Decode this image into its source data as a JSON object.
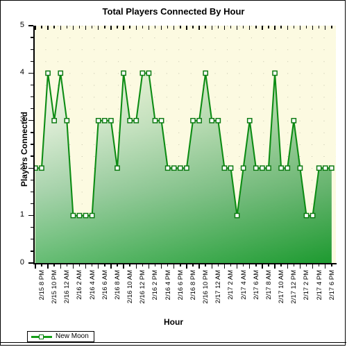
{
  "chart_data": {
    "type": "line",
    "title": "Total Players Connected By Hour",
    "xlabel": "Hour",
    "ylabel": "Players Connected",
    "ylim": [
      0,
      5
    ],
    "ytick_step": 1,
    "yticks": [
      0,
      1,
      2,
      3,
      4,
      5
    ],
    "grid": "dotted",
    "legend_position": "bottom-left",
    "series": [
      {
        "name": "New Moon",
        "color": "#15a018",
        "marker": "square",
        "marker_fill": "#ffffff",
        "x": [
          "2/15 8 PM",
          "2/15 9 PM",
          "2/15 10 PM",
          "2/15 11 PM",
          "2/16 12 AM",
          "2/16 1 AM",
          "2/16 2 AM",
          "2/16 3 AM",
          "2/16 4 AM",
          "2/16 5 AM",
          "2/16 6 AM",
          "2/16 7 AM",
          "2/16 8 AM",
          "2/16 9 AM",
          "2/16 10 AM",
          "2/16 11 AM",
          "2/16 12 PM",
          "2/16 1 PM",
          "2/16 2 PM",
          "2/16 3 PM",
          "2/16 4 PM",
          "2/16 5 PM",
          "2/16 6 PM",
          "2/16 7 PM",
          "2/16 8 PM",
          "2/16 9 PM",
          "2/16 10 PM",
          "2/16 11 PM",
          "2/17 12 AM",
          "2/17 1 AM",
          "2/17 2 AM",
          "2/17 3 AM",
          "2/17 4 AM",
          "2/17 5 AM",
          "2/17 6 AM",
          "2/17 7 AM",
          "2/17 8 AM",
          "2/17 9 AM",
          "2/17 10 AM",
          "2/17 11 AM",
          "2/17 12 PM",
          "2/17 1 PM",
          "2/17 2 PM",
          "2/17 3 PM",
          "2/17 4 PM",
          "2/17 5 PM",
          "2/17 6 PM",
          "2/17 7 PM"
        ],
        "values": [
          2,
          2,
          4,
          3,
          4,
          3,
          1,
          1,
          1,
          1,
          3,
          3,
          3,
          2,
          4,
          3,
          3,
          4,
          4,
          3,
          3,
          2,
          2,
          2,
          2,
          3,
          3,
          4,
          3,
          3,
          2,
          2,
          1,
          2,
          3,
          2,
          2,
          2,
          4,
          2,
          2,
          3,
          2,
          1,
          1,
          2,
          2,
          2
        ]
      }
    ],
    "xtick_labels": [
      "2/15 8 PM",
      "2/15 10 PM",
      "2/16 12 AM",
      "2/16 2 AM",
      "2/16 4 AM",
      "2/16 6 AM",
      "2/16 8 AM",
      "2/16 10 AM",
      "2/16 12 PM",
      "2/16 2 PM",
      "2/16 4 PM",
      "2/16 6 PM",
      "2/16 8 PM",
      "2/16 10 PM",
      "2/17 12 AM",
      "2/17 2 AM",
      "2/17 4 AM",
      "2/17 6 AM",
      "2/17 8 AM",
      "2/17 10 AM",
      "2/17 12 PM",
      "2/17 2 PM",
      "2/17 4 PM",
      "2/17 6 PM"
    ]
  },
  "legend": {
    "entries": [
      {
        "label": "New Moon"
      }
    ]
  },
  "colors": {
    "plot_background": "#fcfae1",
    "line": "#15a018",
    "line_dark": "#0d7a12",
    "area_top": "#fcfae1",
    "area_bottom": "#2aa53a",
    "marker_fill": "#ffffff",
    "axis": "#000000",
    "text": "#000000"
  }
}
